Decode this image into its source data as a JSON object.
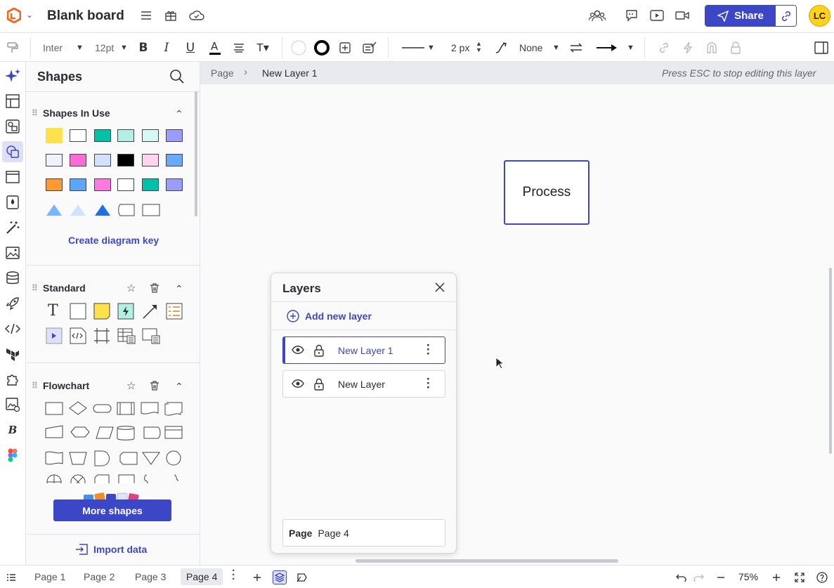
{
  "header": {
    "doc_title": "Blank board",
    "share_label": "Share",
    "avatar_initials": "LC"
  },
  "toolbar": {
    "font_name": "Inter",
    "font_size": "12pt",
    "line_width": "2 px",
    "arrow_start": "None"
  },
  "shapes_panel": {
    "title": "Shapes",
    "in_use_title": "Shapes In Use",
    "create_key_label": "Create diagram key",
    "standard_title": "Standard",
    "flowchart_title": "Flowchart",
    "more_shapes_label": "More shapes",
    "import_label": "Import data",
    "in_use_swatches": [
      "#ffe14d",
      "#ffffff",
      "#00c2a8",
      "#b2efe4",
      "#d6f7f4",
      "#9c9cff",
      "#eef3ff",
      "#ff6bd6",
      "#d1e1ff",
      "#000000",
      "#ffd4f0",
      "#6aa8ff",
      "#ff9933",
      "#5ca6ff",
      "#ff7ae0",
      "#ffffff",
      "#00c2a8",
      "#9c9cff"
    ]
  },
  "breadcrumb": {
    "root": "Page",
    "current": "New Layer 1",
    "hint": "Press ESC to stop editing this layer"
  },
  "canvas": {
    "process_label": "Process"
  },
  "layers_panel": {
    "title": "Layers",
    "add_label": "Add new layer",
    "layers": [
      {
        "name": "New Layer 1"
      },
      {
        "name": "New Layer"
      }
    ],
    "page_label": "Page",
    "page_value": "Page 4"
  },
  "footer": {
    "pages": [
      "Page 1",
      "Page 2",
      "Page 3",
      "Page 4"
    ],
    "zoom": "75%"
  },
  "colors": {
    "accent": "#3b47c6",
    "avatar": "#ffd11a"
  }
}
